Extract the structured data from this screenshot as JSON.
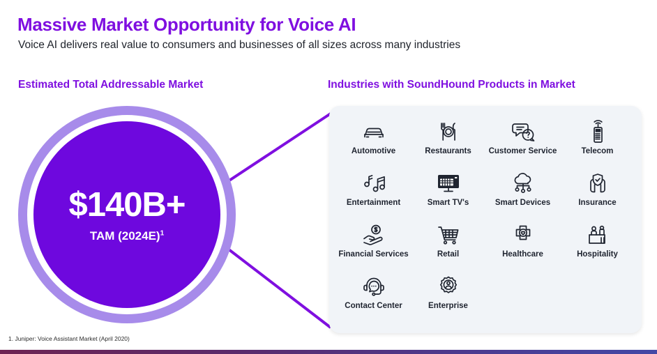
{
  "slide": {
    "title": "Massive Market Opportunity for Voice AI",
    "subtitle": "Voice AI delivers real value to consumers and businesses of all sizes across many industries",
    "footnote": "1. Juniper: Voice Assistant Market (April  2020)",
    "accent_color": "#7F0FE0",
    "circle_fill_color": "#6E08DE",
    "circle_ring_color": "#A78BEA",
    "panel_bg_color": "#F1F4F8",
    "label_color": "#1f2430"
  },
  "tam": {
    "heading": "Estimated Total Addressable Market",
    "value": "$140B+",
    "caption": "TAM (2024E)",
    "caption_superscript": "1"
  },
  "industries": {
    "heading": "Industries with SoundHound Products in Market",
    "items": [
      {
        "label": "Automotive",
        "icon": "car-icon"
      },
      {
        "label": "Restaurants",
        "icon": "cutlery-plate-icon"
      },
      {
        "label": "Customer Service",
        "icon": "speech-bubbles-question-icon"
      },
      {
        "label": "Telecom",
        "icon": "mobile-phone-signal-icon"
      },
      {
        "label": "Entertainment",
        "icon": "music-notes-icon"
      },
      {
        "label": "Smart TV's",
        "icon": "television-icon"
      },
      {
        "label": "Smart Devices",
        "icon": "cloud-iot-icon"
      },
      {
        "label": "Insurance",
        "icon": "hands-shield-icon"
      },
      {
        "label": "Financial Services",
        "icon": "hand-coin-icon"
      },
      {
        "label": "Retail",
        "icon": "shopping-cart-icon"
      },
      {
        "label": "Healthcare",
        "icon": "medical-cross-heart-icon"
      },
      {
        "label": "Hospitality",
        "icon": "reception-desk-icon"
      },
      {
        "label": "Contact Center",
        "icon": "headset-icon"
      },
      {
        "label": "Enterprise",
        "icon": "gear-person-icon"
      }
    ]
  }
}
